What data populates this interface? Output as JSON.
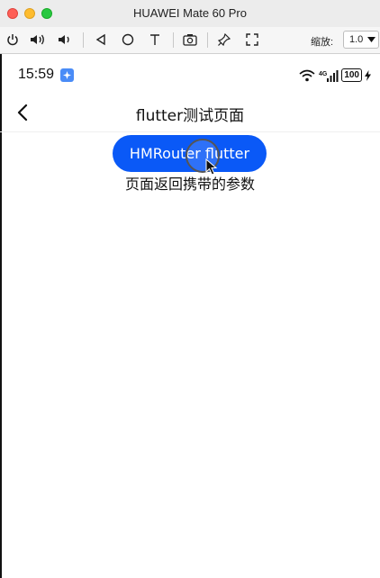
{
  "window": {
    "title": "HUAWEI Mate 60 Pro"
  },
  "toolbar": {
    "zoom_label": "缩放:",
    "zoom_value": "1.0"
  },
  "status_bar": {
    "time": "15:59",
    "battery": "100"
  },
  "header": {
    "title": "flutter测试页面"
  },
  "main": {
    "button_label": "HMRouter flutter",
    "result_text": "页面返回携带的参数"
  },
  "colors": {
    "accent": "#0a59f7",
    "badge": "#4a8cf7"
  }
}
